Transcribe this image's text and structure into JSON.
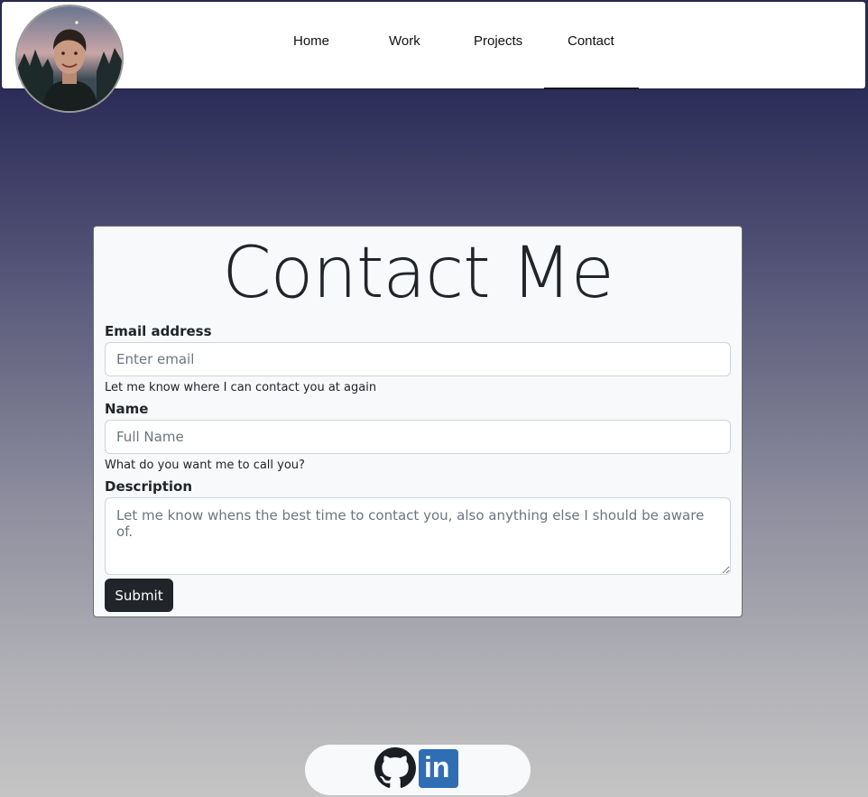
{
  "nav": {
    "items": [
      {
        "label": "Home"
      },
      {
        "label": "Work"
      },
      {
        "label": "Projects"
      },
      {
        "label": "Contact",
        "active": true
      }
    ]
  },
  "form": {
    "title": "Contact Me",
    "email": {
      "label": "Email address",
      "placeholder": "Enter email",
      "help": "Let me know where I can contact you at again"
    },
    "name": {
      "label": "Name",
      "placeholder": "Full Name",
      "help": "What do you want me to call you?"
    },
    "description": {
      "label": "Description",
      "placeholder": "Let me know whens the best time to contact you, also anything else I should be aware of."
    },
    "submit_label": "Submit"
  },
  "social": {
    "icons": [
      "github-icon",
      "linkedin-icon"
    ],
    "linkedin_text": "in"
  },
  "colors": {
    "nav_bg": "#ffffff",
    "button_bg": "#212529",
    "linkedin_blue": "#2f6eb5",
    "gradient_top": "#2b2d58",
    "gradient_bottom": "#c4c4c4"
  }
}
